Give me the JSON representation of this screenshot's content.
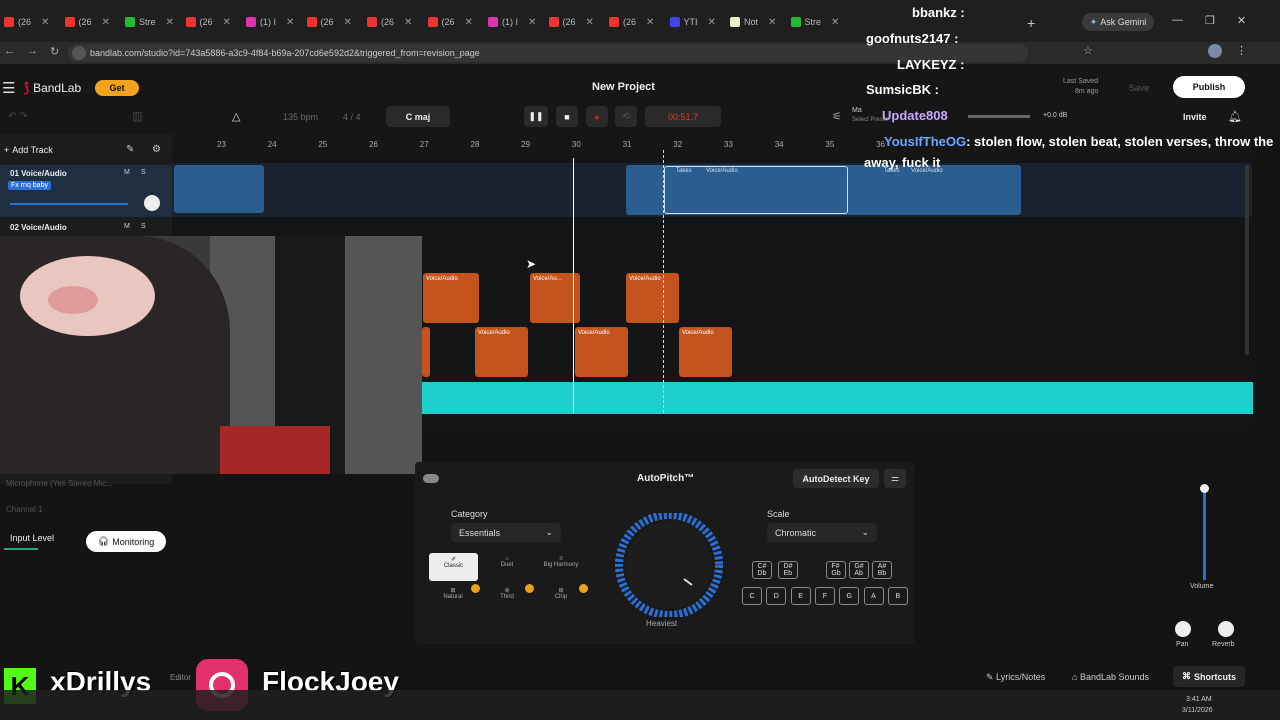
{
  "browser": {
    "tabs": [
      {
        "label": "(26",
        "color": "#e33"
      },
      {
        "label": "(26",
        "color": "#e33"
      },
      {
        "label": "Stre",
        "color": "#2b3"
      },
      {
        "label": "(26",
        "color": "#e33"
      },
      {
        "label": "(1) I",
        "color": "#d3a"
      },
      {
        "label": "(26",
        "color": "#e33"
      },
      {
        "label": "(26",
        "color": "#e33"
      },
      {
        "label": "(26",
        "color": "#e33"
      },
      {
        "label": "(1) I",
        "color": "#d3a"
      },
      {
        "label": "(26",
        "color": "#e33"
      },
      {
        "label": "(26",
        "color": "#e33"
      },
      {
        "label": "YTI",
        "color": "#44e"
      },
      {
        "label": "Not",
        "color": "#eec"
      },
      {
        "label": "Stre",
        "color": "#2b3"
      }
    ],
    "url": "bandlab.com/studio?id=743a5886-a3c9-4f84-b69a-207cd6e592d2&triggered_from=revision_page",
    "ask_gemini": "Ask Gemini"
  },
  "studio": {
    "brand": "BandLab",
    "get_label": "Get",
    "project_title": "New Project",
    "bpm": "135 bpm",
    "time_sig": "4 / 4",
    "key": "C maj",
    "time": "00:51.7",
    "last_saved_label": "Last Saved",
    "last_saved_time": "8m ago",
    "save": "Save",
    "publish": "Publish",
    "invite": "Invite",
    "db_level": "+0.0 dB",
    "master_label": "Ma",
    "preset_label": "Select Preset",
    "add_track": "Add Track",
    "ruler": [
      "23",
      "24",
      "25",
      "26",
      "27",
      "28",
      "29",
      "30",
      "31",
      "32",
      "33",
      "34",
      "35",
      "36"
    ],
    "tracks": [
      {
        "name": "01 Voice/Audio",
        "fx": "Fx rnq baby",
        "m": "M",
        "s": "S"
      },
      {
        "name": "02 Voice/Audio",
        "m": "M",
        "s": "S"
      }
    ],
    "clip_labels": {
      "takes": "Takes",
      "voice": "Voice/Audio",
      "voice_short": "Voice/Au..."
    },
    "input": {
      "device": "Microphone (Yeti Stereo Mic...",
      "channel": "Channel 1",
      "level_label": "Input Level",
      "monitoring": "Monitoring"
    },
    "autopitch": {
      "title": "AutoPitch™",
      "detect": "AutoDetect Key",
      "category_label": "Category",
      "category": "Essentials",
      "presets": [
        "Classic",
        "Duet",
        "Big Harmony",
        "Natural",
        "Third",
        "Chip"
      ],
      "knob_label": "Heaviest",
      "scale_label": "Scale",
      "scale": "Chromatic",
      "sharps": [
        "C#\nDb",
        "D#\nEb",
        "F#\nGb",
        "G#\nAb",
        "A#\nBb"
      ],
      "naturals": [
        "C",
        "D",
        "E",
        "F",
        "G",
        "A",
        "B"
      ]
    },
    "mix": {
      "volume": "Volume",
      "pan": "Pan",
      "reverb": "Reverb"
    },
    "footer": {
      "lyrics": "Lyrics/Notes",
      "sounds": "BandLab Sounds",
      "shortcuts": "Shortcuts",
      "editor": "Editor"
    }
  },
  "chat": [
    {
      "user": "bbankz :",
      "text": "",
      "color": "#fff"
    },
    {
      "user": "goofnuts2147 :",
      "text": "",
      "color": "#fff"
    },
    {
      "user": "LAYKEYZ :",
      "text": "",
      "color": "#fff"
    },
    {
      "user": "SumsicBK :",
      "text": "",
      "color": "#fff"
    },
    {
      "user": "Update808",
      "text": "",
      "color": "#c9a8ff"
    },
    {
      "user": "YousIfTheOG",
      "text": ": stolen flow, stolen beat, stolen verses, throw the",
      "color": "#6aa8ff"
    },
    {
      "user": "",
      "text": "away, fuck it",
      "color": "#fff"
    }
  ],
  "overlay": {
    "left_handle": "xDrillys",
    "right_handle": "FlockJoey"
  },
  "taskbar": {
    "time": "3:41 AM",
    "date": "3/11/2026"
  }
}
